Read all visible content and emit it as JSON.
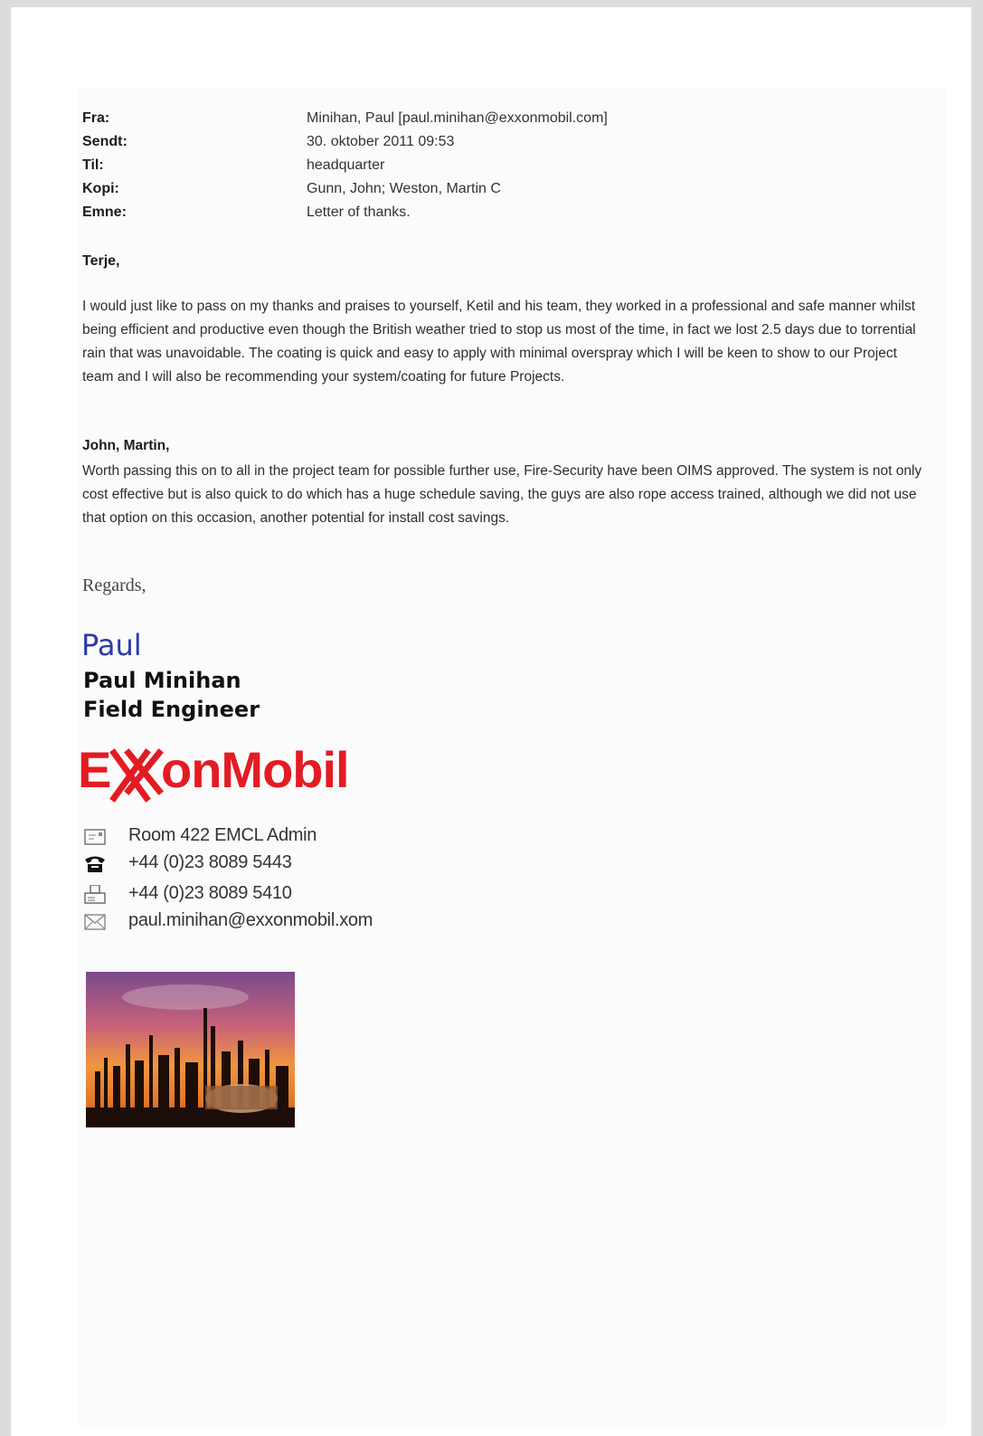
{
  "header": {
    "rows": [
      {
        "label": "Fra:",
        "value": "Minihan, Paul [paul.minihan@exxonmobil.com]"
      },
      {
        "label": "Sendt:",
        "value": "30. oktober 2011 09:53"
      },
      {
        "label": "Til:",
        "value": "headquarter"
      },
      {
        "label": "Kopi:",
        "value": "Gunn, John; Weston, Martin C"
      },
      {
        "label": "Emne:",
        "value": "Letter of thanks."
      }
    ]
  },
  "body": {
    "greeting1": "Terje,",
    "paragraph1": "I would just like to pass on my thanks and praises to yourself, Ketil and his team, they worked in a professional and safe manner whilst being efficient and productive even though the British weather tried to stop us most of the time, in fact we lost 2.5 days due to torrential rain that was unavoidable. The coating is quick and easy to apply with minimal overspray which I will be keen to show to our Project team and I will also be recommending your system/coating for future Projects.",
    "greeting2": "John, Martin,",
    "paragraph2": "Worth passing this on to all in the project team for possible further use, Fire-Security have  been OIMS approved. The system is not only cost effective but is also quick to do which has a huge schedule saving, the guys are also rope access trained, although we did not use that option on this occasion, another potential for install cost savings.",
    "closing": "Regards,"
  },
  "signature": {
    "script_name": "Paul",
    "full_name": "Paul Minihan",
    "title": "Field Engineer",
    "logo_text": "ExxonMobil",
    "contacts": [
      {
        "icon": "address-card-icon",
        "text": "Room 422 EMCL Admin"
      },
      {
        "icon": "telephone-icon",
        "text": "+44 (0)23 8089 5443"
      },
      {
        "icon": "fax-icon",
        "text": "+44 (0)23 8089 5410"
      },
      {
        "icon": "envelope-icon",
        "text": "paul.minihan@exxonmobil.xom"
      }
    ]
  },
  "colors": {
    "logo_red": "#e31b23",
    "script_blue": "#2b3aa8"
  }
}
